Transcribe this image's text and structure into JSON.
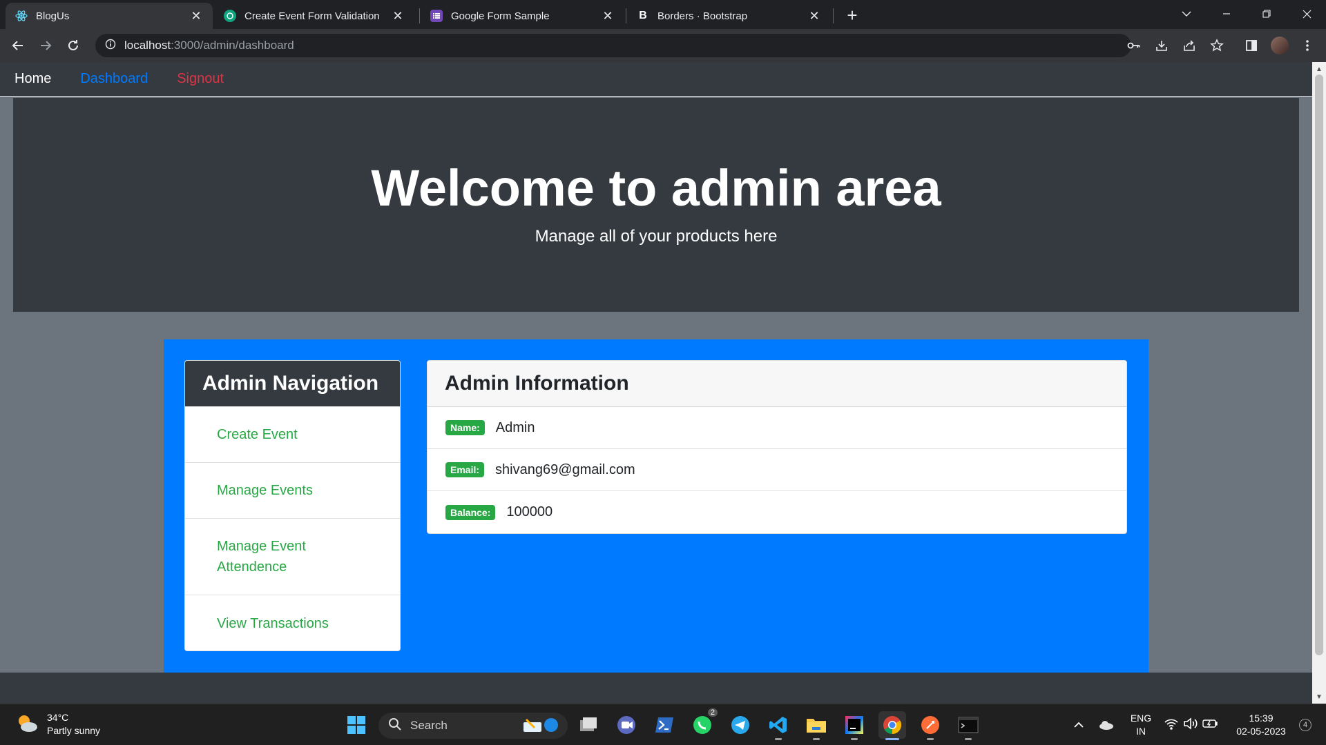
{
  "browser": {
    "tabs": [
      {
        "title": "BlogUs",
        "icon": "react-icon",
        "active": true
      },
      {
        "title": "Create Event Form Validation",
        "icon": "openai-icon",
        "active": false
      },
      {
        "title": "Google Form Sample",
        "icon": "google-forms-icon",
        "active": false
      },
      {
        "title": "Borders · Bootstrap",
        "icon": "bootstrap-icon",
        "active": false
      }
    ],
    "bootstrap_letter": "B",
    "url_host": "localhost",
    "url_path": ":3000/admin/dashboard"
  },
  "site_nav": {
    "home": "Home",
    "dashboard": "Dashboard",
    "signout": "Signout"
  },
  "hero": {
    "title": "Welcome to admin area",
    "subtitle": "Manage all of your products here"
  },
  "admin_nav": {
    "title": "Admin Navigation",
    "items": [
      "Create Event",
      "Manage Events",
      "Manage Event Attendence",
      "View Transactions"
    ]
  },
  "admin_info": {
    "title": "Admin Information",
    "rows": [
      {
        "label": "Name:",
        "value": "Admin"
      },
      {
        "label": "Email:",
        "value": "shivang69@gmail.com"
      },
      {
        "label": "Balance:",
        "value": "100000"
      }
    ]
  },
  "taskbar": {
    "weather_temp": "34°C",
    "weather_desc": "Partly sunny",
    "search_label": "Search",
    "whatsapp_badge": "2",
    "lang_top": "ENG",
    "lang_bottom": "IN",
    "time": "15:39",
    "date": "02-05-2023",
    "notification_count": "4"
  },
  "colors": {
    "primary": "#007bff",
    "success": "#28a745",
    "danger": "#dc3545",
    "dark": "#343a40",
    "secondary": "#6c757d"
  }
}
